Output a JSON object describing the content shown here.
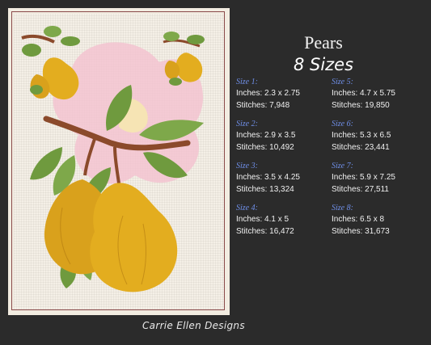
{
  "title": "Pears",
  "subtitle": "8 Sizes",
  "brand": "Carrie Ellen Designs",
  "sizes": [
    {
      "label": "Size 1:",
      "inches": "Inches: 2.3 x 2.75",
      "stitches": "Stitches: 7,948"
    },
    {
      "label": "Size 2:",
      "inches": "Inches: 2.9 x 3.5",
      "stitches": "Stitches: 10,492"
    },
    {
      "label": "Size 3:",
      "inches": "Inches: 3.5 x 4.25",
      "stitches": "Stitches: 13,324"
    },
    {
      "label": "Size 4:",
      "inches": "Inches: 4.1 x 5",
      "stitches": "Stitches: 16,472"
    },
    {
      "label": "Size 5:",
      "inches": "Inches: 4.7 x 5.75",
      "stitches": "Stitches: 19,850"
    },
    {
      "label": "Size 6:",
      "inches": "Inches: 5.3 x 6.5",
      "stitches": "Stitches: 23,441"
    },
    {
      "label": "Size 7:",
      "inches": "Inches: 5.9 x 7.25",
      "stitches": "Stitches: 27,511"
    },
    {
      "label": "Size 8:",
      "inches": "Inches: 6.5 x 8",
      "stitches": "Stitches: 31,673"
    }
  ],
  "colors": {
    "background": "#2b2b2b",
    "size_label": "#6f8fe8",
    "pear": "#e3ad1f",
    "leaf": "#6f9a3e",
    "branch": "#8b4a2b",
    "blossom": "#f0b8c8"
  }
}
